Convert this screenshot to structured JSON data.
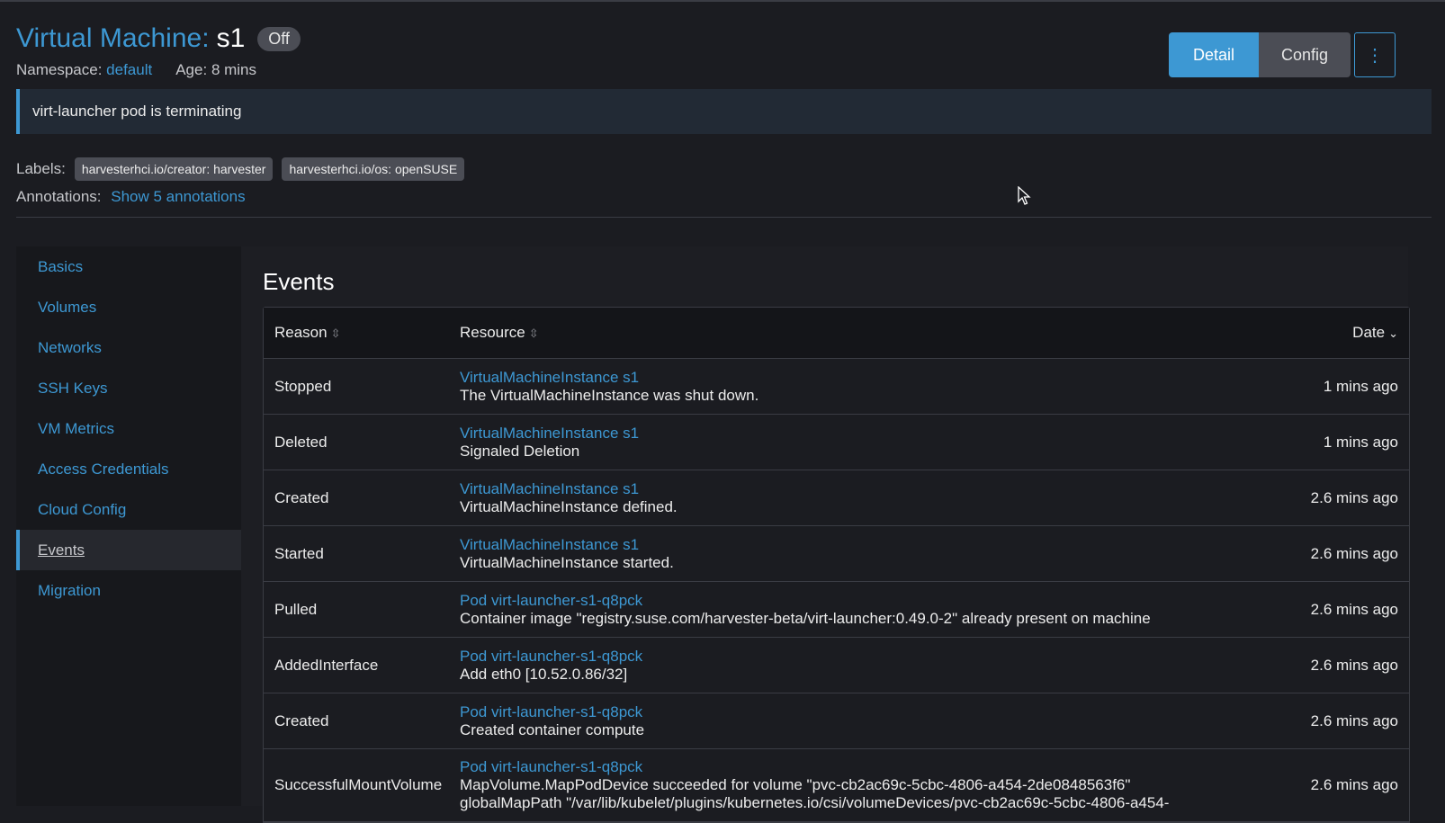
{
  "header": {
    "title_prefix": "Virtual Machine:",
    "title_name": "s1",
    "state": "Off",
    "namespace_label": "Namespace:",
    "namespace_value": "default",
    "age_label": "Age:",
    "age_value": "8 mins"
  },
  "actions": {
    "detail": "Detail",
    "config": "Config",
    "more": "⋮"
  },
  "banner": {
    "message": "virt-launcher pod is terminating"
  },
  "labels": {
    "label": "Labels:",
    "tags": [
      "harvesterhci.io/creator: harvester",
      "harvesterhci.io/os: openSUSE"
    ]
  },
  "annotations": {
    "label": "Annotations:",
    "link": "Show 5 annotations"
  },
  "sidebar": {
    "items": [
      {
        "label": "Basics"
      },
      {
        "label": "Volumes"
      },
      {
        "label": "Networks"
      },
      {
        "label": "SSH Keys"
      },
      {
        "label": "VM Metrics"
      },
      {
        "label": "Access Credentials"
      },
      {
        "label": "Cloud Config"
      },
      {
        "label": "Events",
        "active": true
      },
      {
        "label": "Migration"
      }
    ]
  },
  "events": {
    "title": "Events",
    "columns": {
      "reason": "Reason",
      "resource": "Resource",
      "date": "Date"
    },
    "rows": [
      {
        "reason": "Stopped",
        "resource": "VirtualMachineInstance s1",
        "message": "The VirtualMachineInstance was shut down.",
        "date": "1 mins ago"
      },
      {
        "reason": "Deleted",
        "resource": "VirtualMachineInstance s1",
        "message": "Signaled Deletion",
        "date": "1 mins ago"
      },
      {
        "reason": "Created",
        "resource": "VirtualMachineInstance s1",
        "message": "VirtualMachineInstance defined.",
        "date": "2.6 mins ago"
      },
      {
        "reason": "Started",
        "resource": "VirtualMachineInstance s1",
        "message": "VirtualMachineInstance started.",
        "date": "2.6 mins ago"
      },
      {
        "reason": "Pulled",
        "resource": "Pod virt-launcher-s1-q8pck",
        "message": "Container image \"registry.suse.com/harvester-beta/virt-launcher:0.49.0-2\" already present on machine",
        "date": "2.6 mins ago"
      },
      {
        "reason": "AddedInterface",
        "resource": "Pod virt-launcher-s1-q8pck",
        "message": "Add eth0 [10.52.0.86/32]",
        "date": "2.6 mins ago"
      },
      {
        "reason": "Created",
        "resource": "Pod virt-launcher-s1-q8pck",
        "message": "Created container compute",
        "date": "2.6 mins ago"
      },
      {
        "reason": "SuccessfulMountVolume",
        "resource": "Pod virt-launcher-s1-q8pck",
        "message": "MapVolume.MapPodDevice succeeded for volume \"pvc-cb2ac69c-5cbc-4806-a454-2de0848563f6\"",
        "message2": "globalMapPath \"/var/lib/kubelet/plugins/kubernetes.io/csi/volumeDevices/pvc-cb2ac69c-5cbc-4806-a454-",
        "date": "2.6 mins ago"
      }
    ]
  }
}
